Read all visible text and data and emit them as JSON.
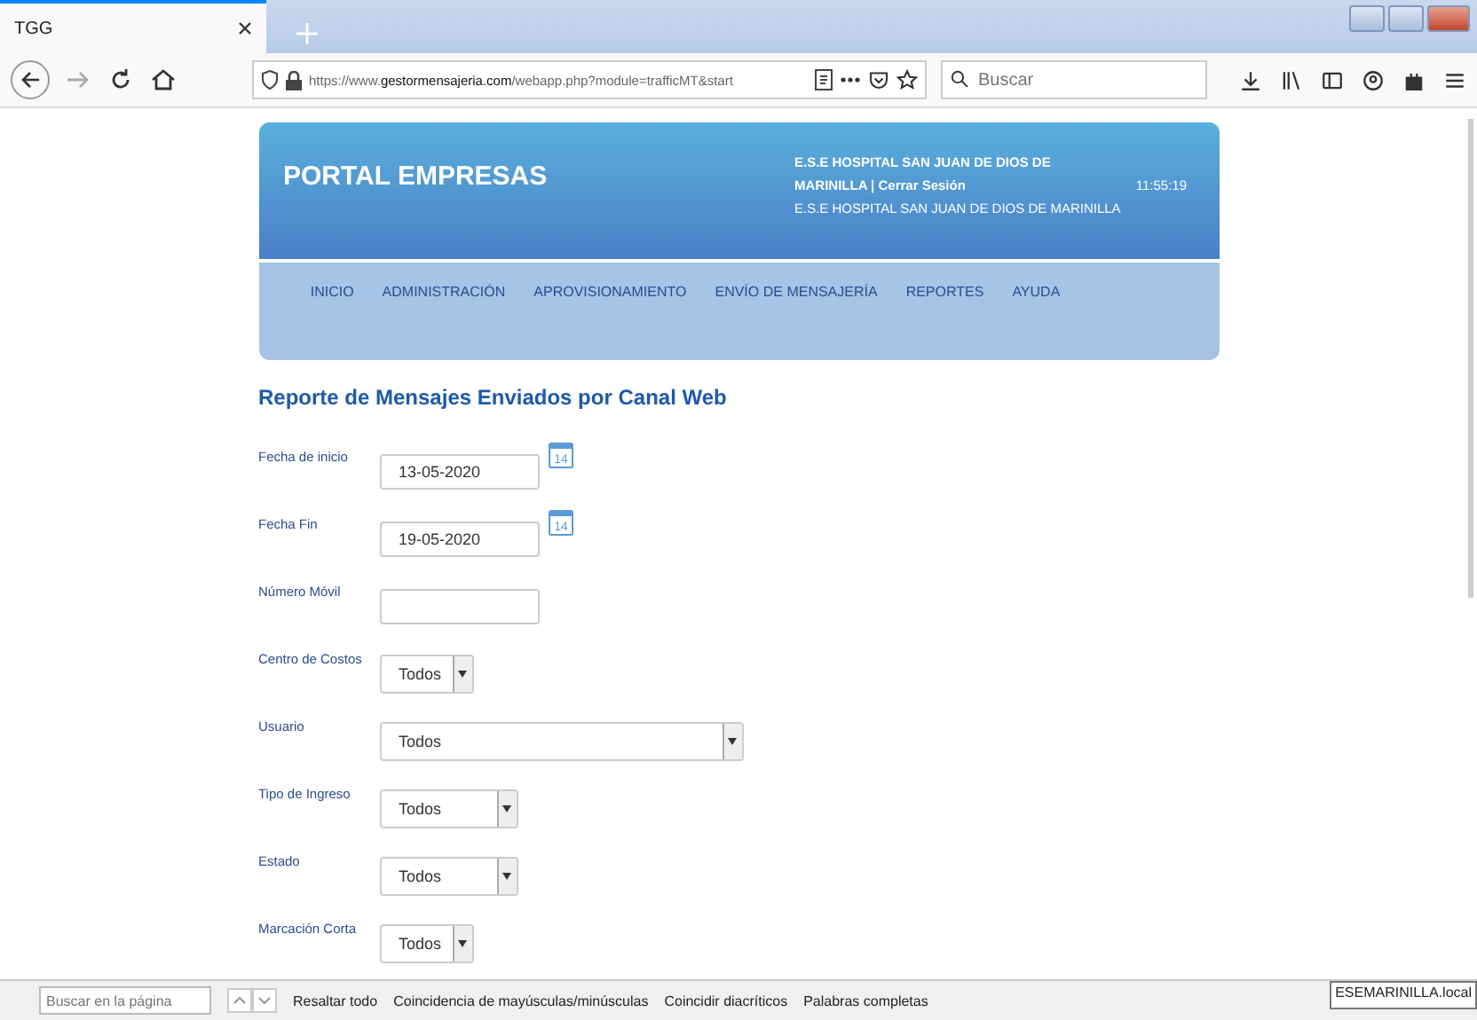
{
  "browser": {
    "tab": {
      "title": "TGG"
    },
    "url": "https://www.**gestormensajeria.com**/webapp.php?module=trafficMT&start",
    "search": {
      "placeholder": "Buscar"
    }
  },
  "header": {
    "title": "PORTAL EMPRESAS",
    "user_line": "E.S.E HOSPITAL  SAN JUAN DE DIOS DE MARINILLA | Cerrar Sesión",
    "time": "11:55:19",
    "org": "E.S.E HOSPITAL SAN JUAN DE DIOS DE MARINILLA"
  },
  "menu": [
    "INICIO",
    "ADMINISTRACIÓN",
    "APROVISIONAMIENTO",
    "ENVÍO DE MENSAJERÍA",
    "REPORTES",
    "AYUDA"
  ],
  "form": {
    "title": "Reporte de Mensajes Enviados por Canal Web",
    "fields": [
      {
        "kind": "date",
        "label": "Fecha de inicio",
        "value": "13-05-2020",
        "calendar_day": "14"
      },
      {
        "kind": "date",
        "label": "Fecha Fin",
        "value": "19-05-2020",
        "calendar_day": "14"
      },
      {
        "kind": "text",
        "label": "Número Móvil"
      },
      {
        "kind": "select",
        "label": "Centro de Costos",
        "value": "Todos",
        "wide": false
      },
      {
        "kind": "select",
        "label": "Usuario",
        "value": "Todos",
        "wide": true
      },
      {
        "kind": "select",
        "label": "Tipo de Ingreso",
        "value": "Todos",
        "wide": false
      },
      {
        "kind": "select",
        "label": "Estado",
        "value": "Todos",
        "wide": false
      },
      {
        "kind": "select",
        "label": "Marcación Corta",
        "value": "Todos",
        "wide": false
      }
    ]
  },
  "find_bar": {
    "placeholder": "Buscar en la página",
    "options": [
      "Resaltar todo",
      "Coincidencia de mayúsculas/minúsculas",
      "Coincidir diacríticos",
      "Palabras completas"
    ]
  },
  "status": "ESEMARINILLA.local"
}
